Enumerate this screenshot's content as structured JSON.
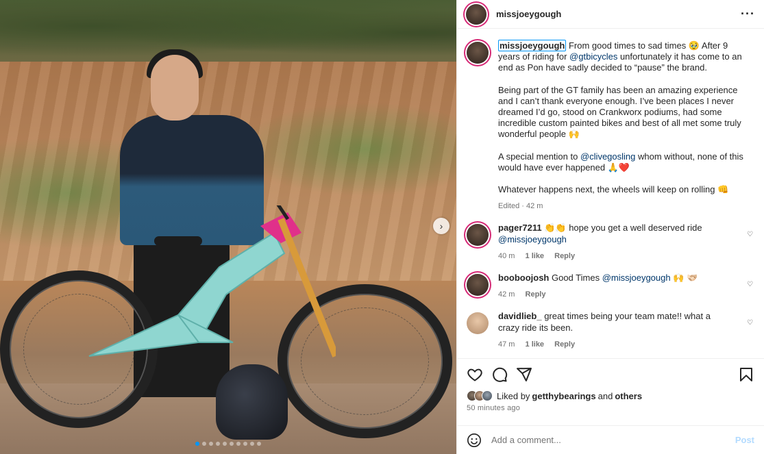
{
  "post": {
    "username": "missjoeygough",
    "more_icon": "more-horizontal-icon",
    "media": {
      "carousel_dots": 10,
      "active_dot": 0,
      "next_icon": "chevron-right-icon"
    }
  },
  "caption": {
    "username": "missjoeygough",
    "p1_a": "From good times to sad times 🥹 After 9 years of riding for ",
    "p1_mention": "@gtbicycles",
    "p1_b": " unfortunately it has come to an end as Pon have sadly decided to “pause” the brand.",
    "p2": "Being part of the GT family has been an amazing experience and I can’t thank everyone enough. I’ve been places I never dreamed I’d go, stood on Crankworx podiums, had some incredible custom painted bikes and best of all met some truly wonderful people 🙌",
    "p3_a": "A special mention to ",
    "p3_mention": "@clivegosling",
    "p3_b": " whom without, none of this would have ever happened 🙏❤️",
    "p4": "Whatever happens next, the wheels will keep on rolling 👊",
    "meta": "Edited · 42 m"
  },
  "comments": [
    {
      "user": "pager7211",
      "text_a": " 👏👏 hope you get a well deserved ride ",
      "mention": "@missjoeygough",
      "text_b": "",
      "time": "40 m",
      "likes": "1 like",
      "reply": "Reply"
    },
    {
      "user": "booboojosh",
      "text_a": " Good Times ",
      "mention": "@missjoeygough",
      "text_b": " 🙌 🫱🏻‍🫲🏼",
      "time": "42 m",
      "likes": "",
      "reply": "Reply"
    },
    {
      "user": "davidlieb_",
      "text_a": " great times being your team mate!! what a crazy ride its been.",
      "mention": "",
      "text_b": "",
      "time": "47 m",
      "likes": "1 like",
      "reply": "Reply"
    }
  ],
  "actions": {
    "icons": [
      "heart-icon",
      "comment-icon",
      "share-icon",
      "bookmark-icon"
    ],
    "liked_by_prefix": "Liked by ",
    "liked_by_user": "getthybearings",
    "liked_by_and": " and ",
    "liked_by_others": "others",
    "posted_ago": "50 minutes ago"
  },
  "add_comment": {
    "placeholder": "Add a comment...",
    "post_label": "Post",
    "emoji_icon": "emoji-icon"
  },
  "colors": {
    "accent": "#0095f6",
    "mention": "#00376b",
    "post_disabled": "#b3dbff",
    "muted": "#737373"
  }
}
